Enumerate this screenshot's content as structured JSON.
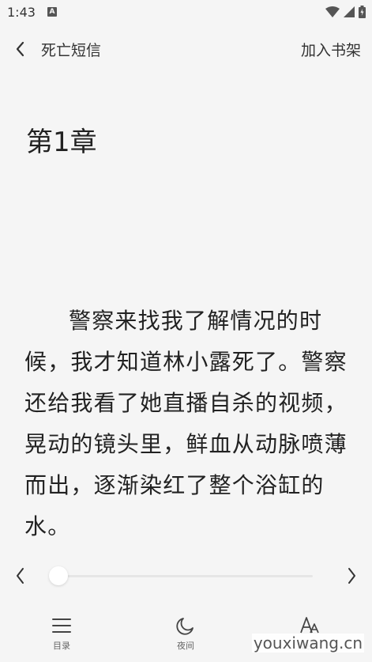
{
  "status_bar": {
    "time": "1:43",
    "notification_icon": "A"
  },
  "header": {
    "book_title": "死亡短信",
    "add_to_shelf": "加入书架"
  },
  "chapter": {
    "title": "第1章",
    "body": "警察来找我了解情况的时候，我才知道林小露死了。警察还给我看了她直播自杀的视频，晃动的镜头里，鲜血从动脉喷薄而出，逐渐染红了整个浴缸的水。"
  },
  "reader": {
    "progress": 0
  },
  "bottom_bar": {
    "catalog": "目录",
    "night": "夜间",
    "settings": "设置"
  },
  "watermark": "youxiwang.cn",
  "icons": [
    "wifi-icon",
    "signal-icon",
    "battery-icon",
    "back-arrow-icon",
    "chevron-left-icon",
    "chevron-right-icon",
    "menu-icon",
    "moon-icon",
    "font-icon"
  ]
}
